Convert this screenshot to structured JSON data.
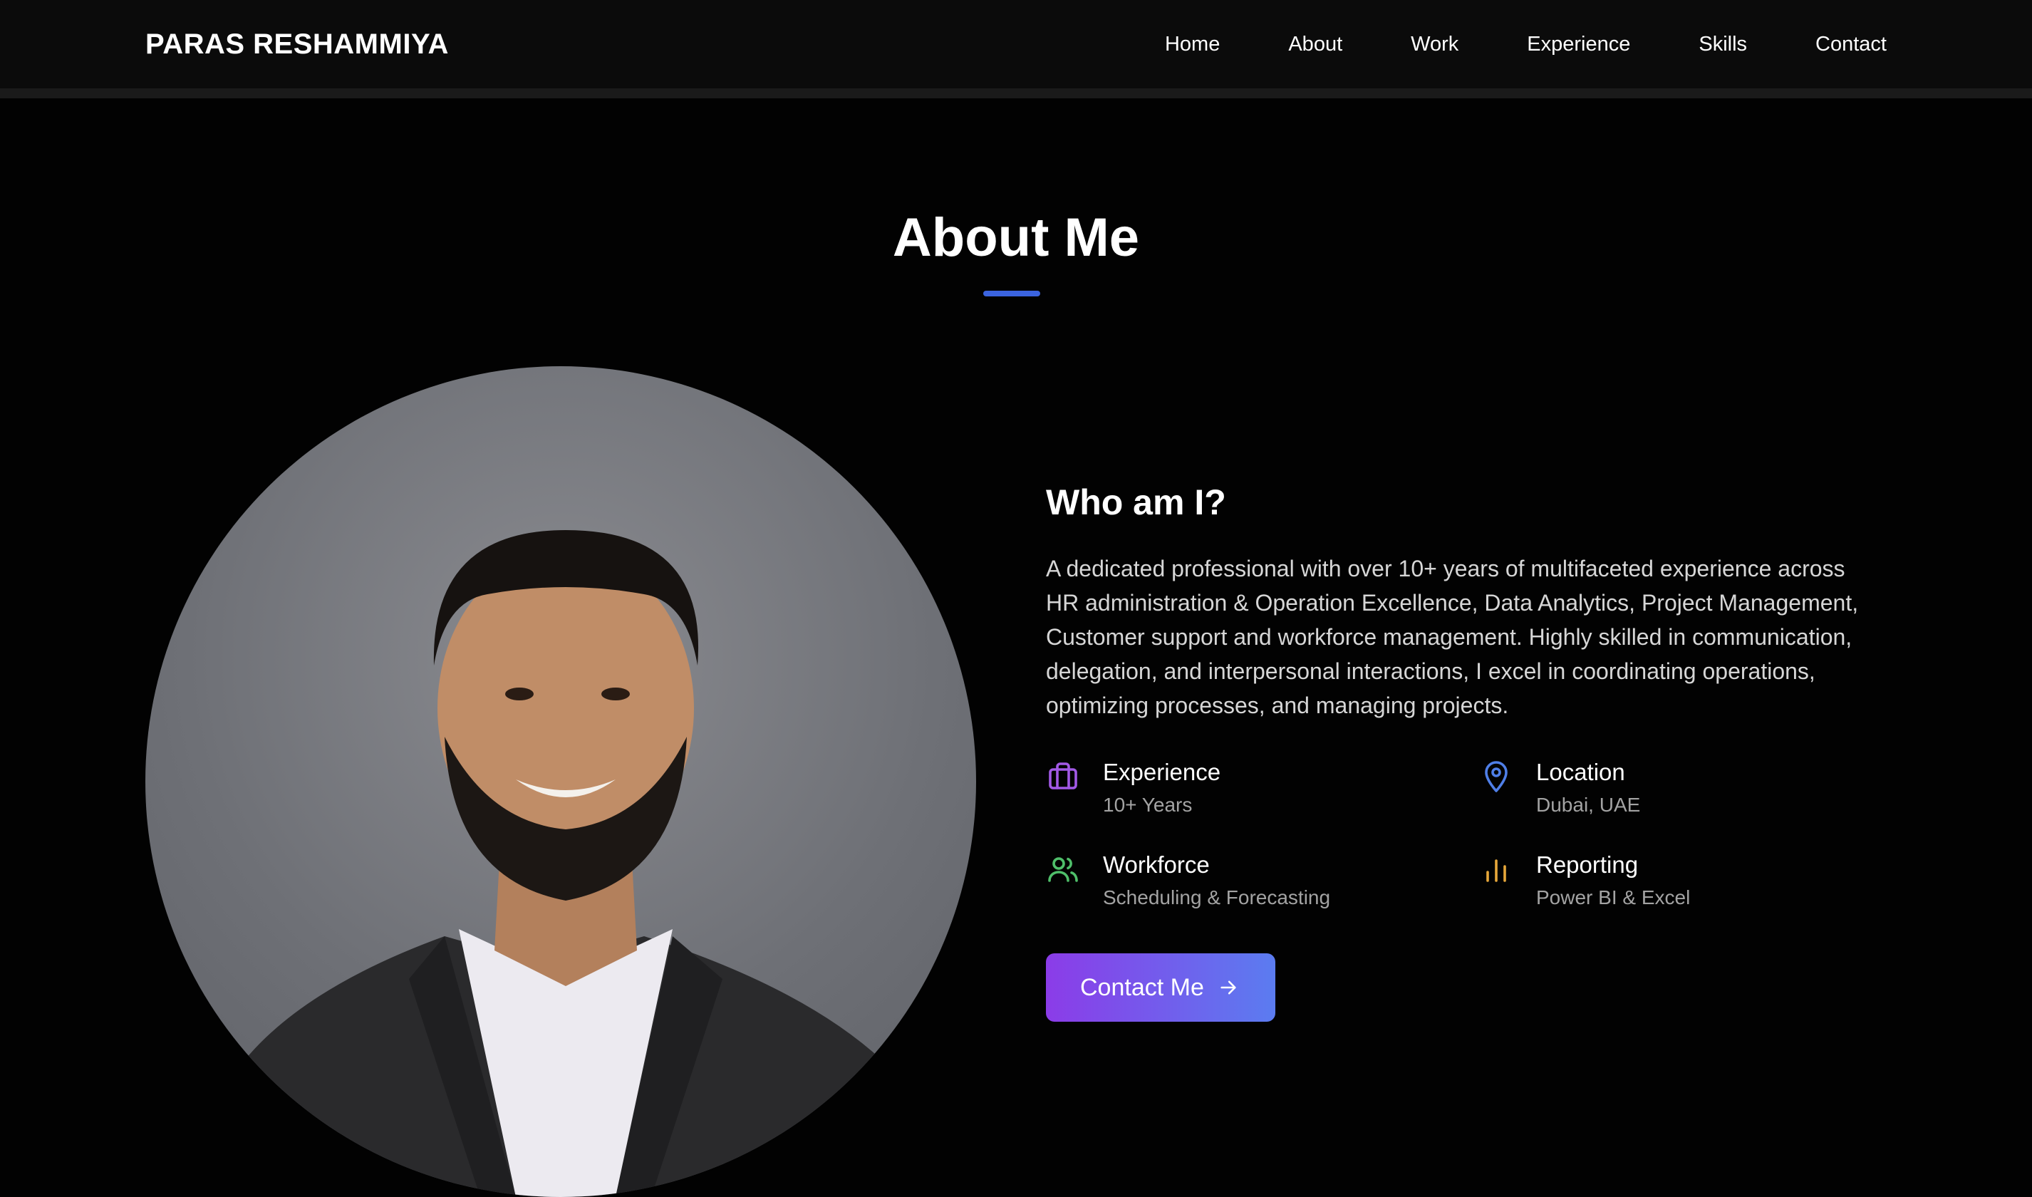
{
  "navbar": {
    "brand": "PARAS RESHAMMIYA",
    "links": [
      {
        "label": "Home"
      },
      {
        "label": "About"
      },
      {
        "label": "Work"
      },
      {
        "label": "Experience"
      },
      {
        "label": "Skills"
      },
      {
        "label": "Contact"
      }
    ]
  },
  "about": {
    "heading": "About Me",
    "accent_color": "#3b64e0",
    "subheading": "Who am I?",
    "bio": "A dedicated professional with over 10+ years of multifaceted experience across HR administration & Operation Excellence, Data Analytics, Project Management, Customer support and workforce management. Highly skilled in communication, delegation, and interpersonal interactions, I excel in coordinating operations, optimizing processes, and managing projects.",
    "facts": [
      {
        "icon": "briefcase-icon",
        "color": "#a259e6",
        "title": "Experience",
        "value": "10+ Years"
      },
      {
        "icon": "map-pin-icon",
        "color": "#4f7fe8",
        "title": "Location",
        "value": "Dubai, UAE"
      },
      {
        "icon": "users-icon",
        "color": "#4fbf6a",
        "title": "Workforce",
        "value": "Scheduling & Forecasting"
      },
      {
        "icon": "bar-chart-icon",
        "color": "#e7a73a",
        "title": "Reporting",
        "value": "Power BI & Excel"
      }
    ],
    "cta": {
      "label": "Contact Me",
      "icon": "arrow-right-icon",
      "gradient": [
        "#8b3ce8",
        "#5b7cf0"
      ]
    }
  }
}
